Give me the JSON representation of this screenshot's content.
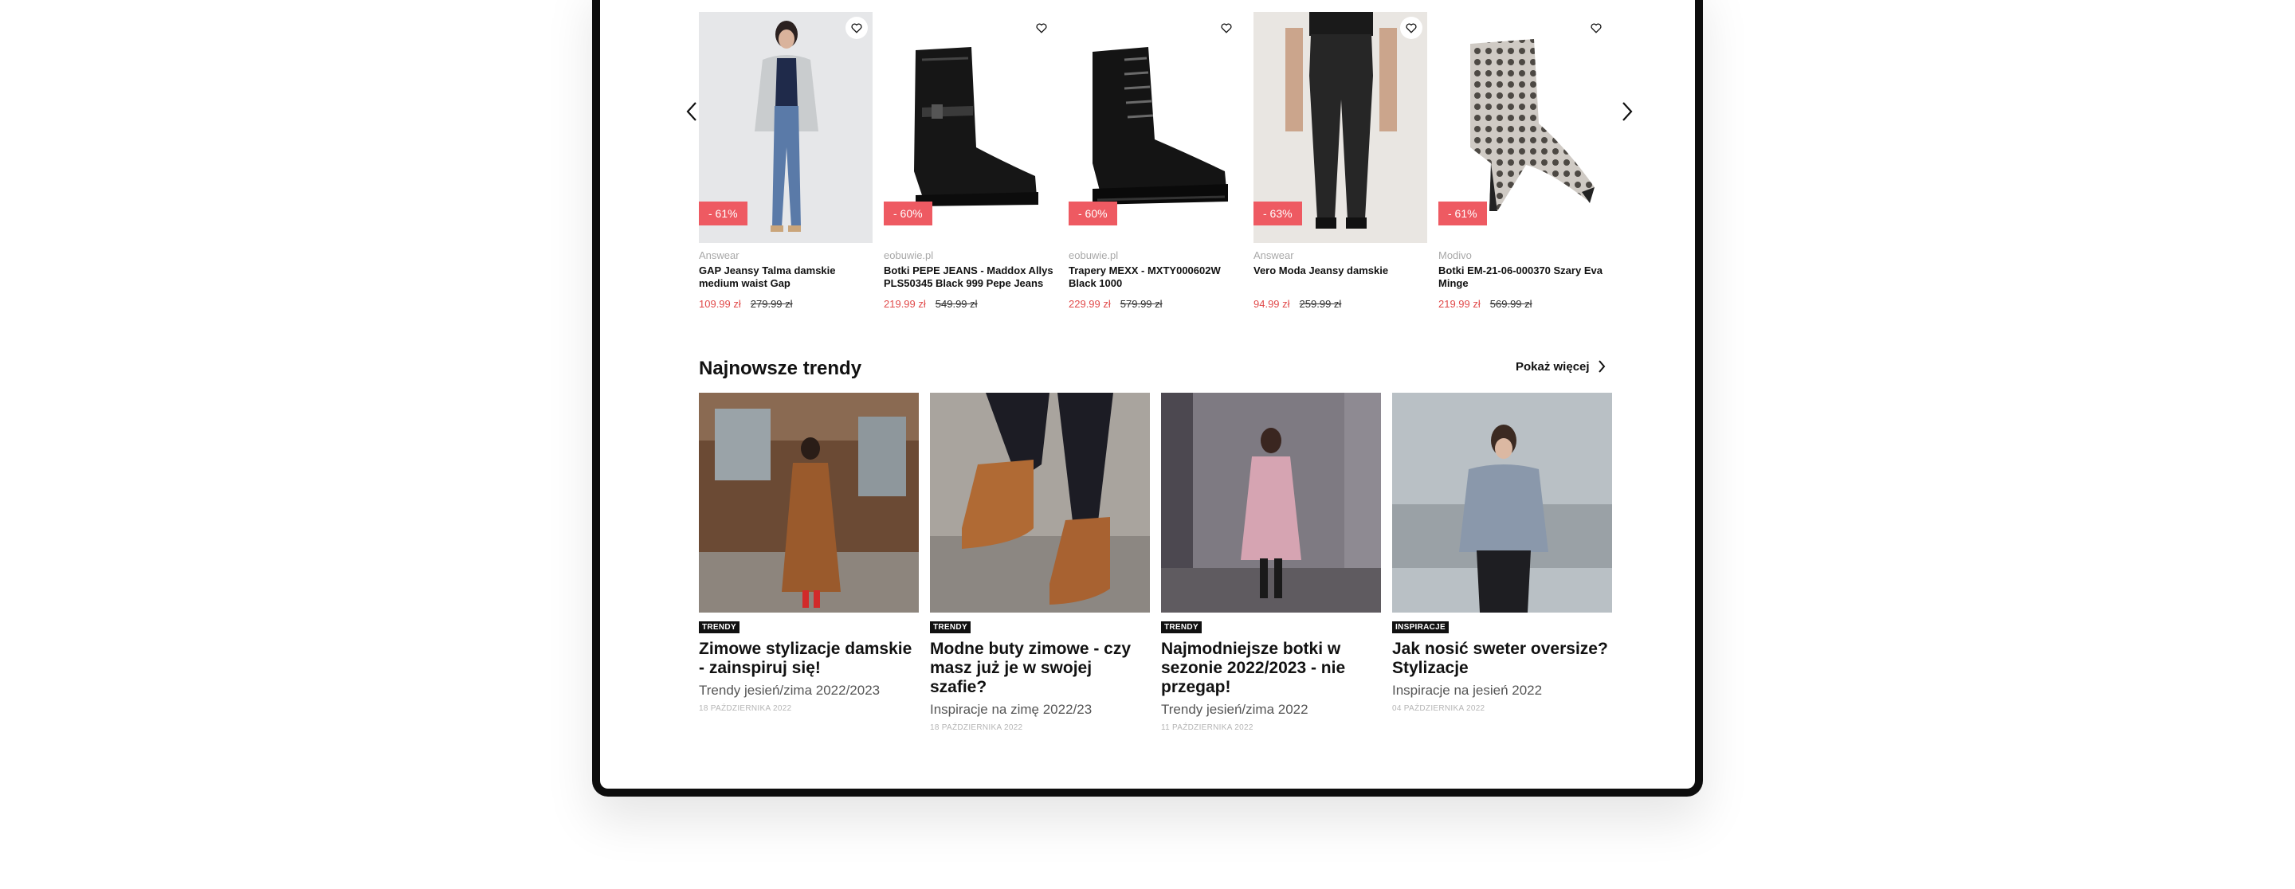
{
  "products": [
    {
      "store": "Answear",
      "name": "GAP Jeansy Talma damskie medium waist Gap",
      "price_new": "109.99 zł",
      "price_old": "279.99 zł",
      "discount": "- 61%"
    },
    {
      "store": "eobuwie.pl",
      "name": "Botki PEPE JEANS - Maddox Allys PLS50345 Black 999 Pepe Jeans",
      "price_new": "219.99 zł",
      "price_old": "549.99 zł",
      "discount": "- 60%"
    },
    {
      "store": "eobuwie.pl",
      "name": "Trapery MEXX - MXTY000602W Black 1000",
      "price_new": "229.99 zł",
      "price_old": "579.99 zł",
      "discount": "- 60%"
    },
    {
      "store": "Answear",
      "name": "Vero Moda Jeansy damskie",
      "price_new": "94.99 zł",
      "price_old": "259.99 zł",
      "discount": "- 63%"
    },
    {
      "store": "Modivo",
      "name": "Botki EM-21-06-000370 Szary Eva Minge",
      "price_new": "219.99 zł",
      "price_old": "569.99 zł",
      "discount": "- 61%"
    }
  ],
  "trends": {
    "title": "Najnowsze trendy",
    "show_more": "Pokaż więcej",
    "articles": [
      {
        "tag": "TRENDY",
        "title": "Zimowe stylizacje damskie - zainspiruj się!",
        "subtitle": "Trendy jesień/zima 2022/2023",
        "date": "18 PAŹDZIERNIKA 2022"
      },
      {
        "tag": "TRENDY",
        "title": "Modne buty zimowe - czy masz już je w swojej szafie?",
        "subtitle": "Inspiracje na zimę 2022/23",
        "date": "18 PAŹDZIERNIKA 2022"
      },
      {
        "tag": "TRENDY",
        "title": "Najmodniejsze botki w sezonie 2022/2023 - nie przegap!",
        "subtitle": "Trendy jesień/zima 2022",
        "date": "11 PAŹDZIERNIKA 2022"
      },
      {
        "tag": "INSPIRACJE",
        "title": "Jak nosić sweter oversize? Stylizacje",
        "subtitle": "Inspiracje na jesień 2022",
        "date": "04 PAŹDZIERNIKA 2022"
      }
    ]
  },
  "icons": {
    "prev": "chevron-left-icon",
    "next": "chevron-right-icon",
    "favorite": "heart-icon",
    "more": "chevron-right-icon"
  },
  "colors": {
    "discount": "#ee5a62",
    "price_new": "#e14b4b",
    "tag_bg": "#111111",
    "frame": "#0d0d0d"
  }
}
